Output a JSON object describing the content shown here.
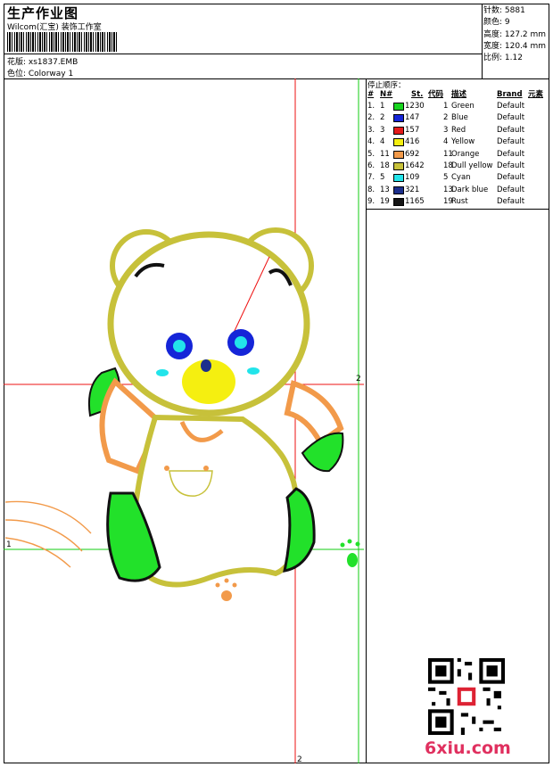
{
  "header": {
    "title": "生产作业图",
    "company": "Wilcom(汇宝) 装饰工作室",
    "design_label": "花版: xs1837.EMB",
    "colorway_label": "色位:  Colorway 1"
  },
  "stats": {
    "stitches": "针数: 5881",
    "colors": "颜色: 9",
    "height": "高度: 127.2 mm",
    "width": "宽度: 120.4 mm",
    "scale": "比例: 1.12"
  },
  "sequence": {
    "title": "停止顺序：",
    "headers": {
      "no": "#",
      "n": "N#",
      "st": "St.",
      "code": "代码",
      "desc": "描述",
      "brand": "Brand",
      "elem": "元素"
    },
    "rows": [
      {
        "no": "1.",
        "n": "1",
        "color": "#17d41f",
        "st": "1230",
        "code": "1",
        "desc": "Green",
        "brand": "Default"
      },
      {
        "no": "2.",
        "n": "2",
        "color": "#1525d8",
        "st": "147",
        "code": "2",
        "desc": "Blue",
        "brand": "Default"
      },
      {
        "no": "3.",
        "n": "3",
        "color": "#e31a1a",
        "st": "157",
        "code": "3",
        "desc": "Red",
        "brand": "Default"
      },
      {
        "no": "4.",
        "n": "4",
        "color": "#f5ef10",
        "st": "416",
        "code": "4",
        "desc": "Yellow",
        "brand": "Default"
      },
      {
        "no": "5.",
        "n": "11",
        "color": "#f29a4a",
        "st": "692",
        "code": "11",
        "desc": "Orange",
        "brand": "Default"
      },
      {
        "no": "6.",
        "n": "18",
        "color": "#c7c13a",
        "st": "1642",
        "code": "18",
        "desc": "Dull yellow",
        "brand": "Default"
      },
      {
        "no": "7.",
        "n": "5",
        "color": "#22e4ea",
        "st": "109",
        "code": "5",
        "desc": "Cyan",
        "brand": "Default"
      },
      {
        "no": "8.",
        "n": "13",
        "color": "#1c2f8c",
        "st": "321",
        "code": "13",
        "desc": "Dark blue",
        "brand": "Default"
      },
      {
        "no": "9.",
        "n": "19",
        "color": "#151515",
        "st": "1165",
        "code": "19",
        "desc": "Rust",
        "brand": "Default"
      }
    ]
  },
  "markers": {
    "m1": "1",
    "m2_top": "2",
    "m2_bottom": "2"
  },
  "watermark": "6xiu.com"
}
